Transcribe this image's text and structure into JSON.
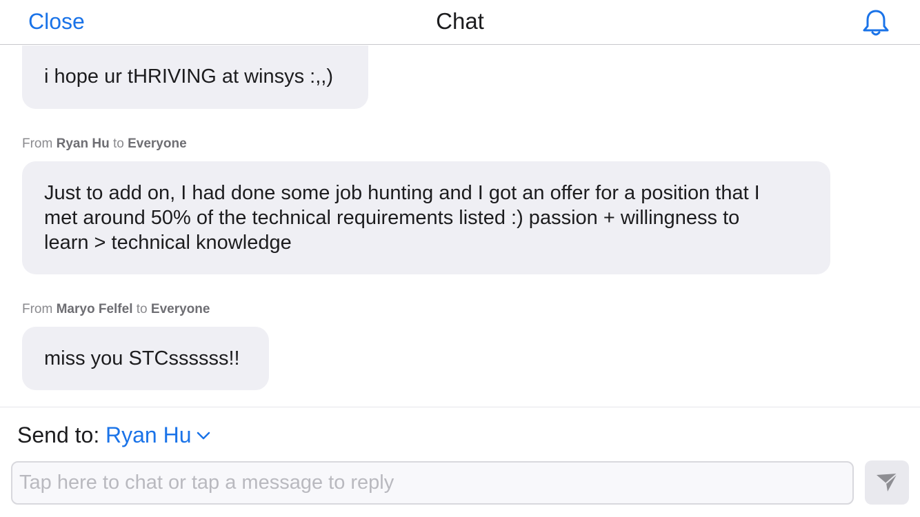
{
  "header": {
    "close_label": "Close",
    "title": "Chat"
  },
  "icons": {
    "bell": "bell-icon",
    "chevron": "chevron-down-icon",
    "send": "send-icon"
  },
  "colors": {
    "accent": "#1a73e8",
    "bubble_bg": "#efeff4",
    "meta_text": "#8a8a8e"
  },
  "messages": [
    {
      "text": "i hope ur tHRIVING at winsys :,,)"
    },
    {
      "from_prefix": "From",
      "sender": "Ryan Hu",
      "to_word": "to",
      "recipient": "Everyone",
      "lines": [
        "Just to add on, I had done some job hunting and I got an offer for a position that I",
        "met around 50% of the technical requirements listed :) passion + willingness to",
        "learn > technical knowledge"
      ]
    },
    {
      "from_prefix": "From",
      "sender": "Maryo Felfel",
      "to_word": "to",
      "recipient": "Everyone",
      "text": "miss you STCssssss!!"
    }
  ],
  "composer": {
    "send_to_label": "Send to:",
    "recipient": "Ryan Hu",
    "input_value": "",
    "placeholder": "Tap here to chat or tap a message to reply"
  }
}
